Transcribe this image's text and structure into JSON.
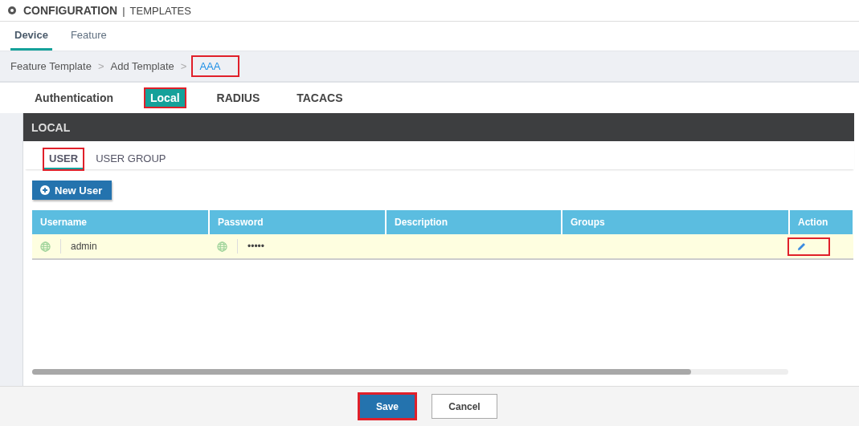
{
  "header": {
    "title": "CONFIGURATION",
    "divider": "|",
    "subtitle": "TEMPLATES"
  },
  "breadcrumb_separator": ">",
  "top_tabs": [
    {
      "label": "Device",
      "selected": true
    },
    {
      "label": "Feature",
      "selected": false
    }
  ],
  "breadcrumb": [
    {
      "label": "Feature Template",
      "current": false,
      "highlighted": false
    },
    {
      "label": "Add Template",
      "current": false,
      "highlighted": false
    },
    {
      "label": "AAA",
      "current": true,
      "highlighted": true
    }
  ],
  "section_tabs": [
    {
      "label": "Authentication",
      "selected": false,
      "highlighted": false
    },
    {
      "label": "Local",
      "selected": true,
      "highlighted": true
    },
    {
      "label": "RADIUS",
      "selected": false,
      "highlighted": false
    },
    {
      "label": "TACACS",
      "selected": false,
      "highlighted": false
    }
  ],
  "panel": {
    "title": "LOCAL",
    "tabs": [
      {
        "label": "USER",
        "selected": true,
        "highlighted": true
      },
      {
        "label": "USER GROUP",
        "selected": false,
        "highlighted": false
      }
    ],
    "new_button": "New User",
    "table": {
      "columns": [
        "Username",
        "Password",
        "Description",
        "Groups",
        "Action"
      ],
      "rows": [
        {
          "username": "admin",
          "password": "•••••",
          "action_highlighted": true
        }
      ]
    }
  },
  "footer": {
    "buttons": [
      {
        "label": "Save",
        "kind": "primary",
        "highlighted": true
      },
      {
        "label": "Cancel",
        "kind": "secondary",
        "highlighted": false
      }
    ]
  }
}
